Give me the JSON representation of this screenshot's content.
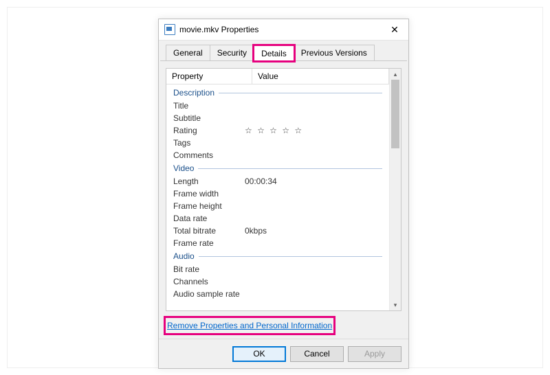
{
  "window": {
    "title": "movie.mkv Properties"
  },
  "tabs": {
    "general": "General",
    "security": "Security",
    "details": "Details",
    "previous": "Previous Versions"
  },
  "headers": {
    "property": "Property",
    "value": "Value"
  },
  "groups": {
    "description": "Description",
    "video": "Video",
    "audio": "Audio"
  },
  "properties": {
    "title": {
      "label": "Title",
      "value": ""
    },
    "subtitle": {
      "label": "Subtitle",
      "value": ""
    },
    "rating": {
      "label": "Rating",
      "value": "☆ ☆ ☆ ☆ ☆"
    },
    "tags": {
      "label": "Tags",
      "value": ""
    },
    "comments": {
      "label": "Comments",
      "value": ""
    },
    "length": {
      "label": "Length",
      "value": "00:00:34"
    },
    "frame_width": {
      "label": "Frame width",
      "value": ""
    },
    "frame_height": {
      "label": "Frame height",
      "value": ""
    },
    "data_rate": {
      "label": "Data rate",
      "value": ""
    },
    "total_bitrate": {
      "label": "Total bitrate",
      "value": "0kbps"
    },
    "frame_rate": {
      "label": "Frame rate",
      "value": ""
    },
    "bit_rate": {
      "label": "Bit rate",
      "value": ""
    },
    "channels": {
      "label": "Channels",
      "value": ""
    },
    "audio_sample_rate": {
      "label": "Audio sample rate",
      "value": ""
    }
  },
  "link": {
    "remove": "Remove Properties and Personal Information"
  },
  "buttons": {
    "ok": "OK",
    "cancel": "Cancel",
    "apply": "Apply"
  }
}
